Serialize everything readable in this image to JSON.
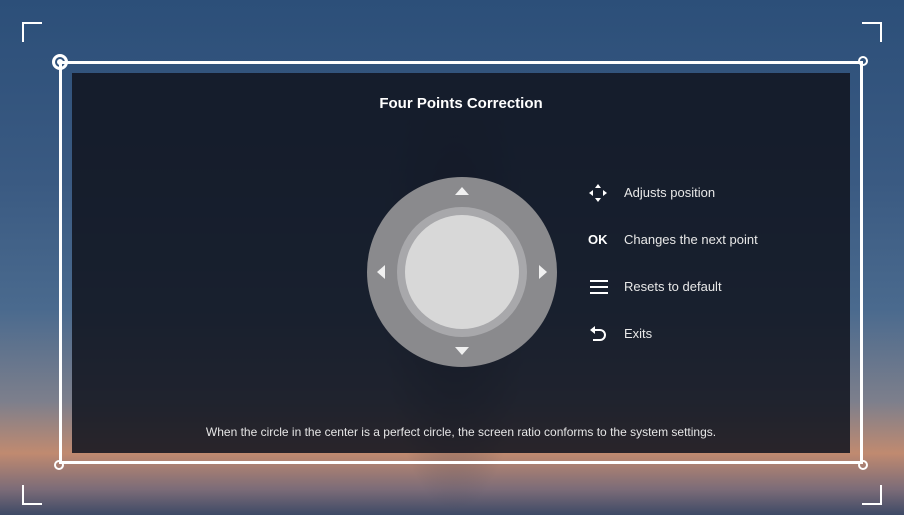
{
  "title": "Four Points Correction",
  "legend": [
    {
      "icon": "directional-arrows-icon",
      "label": "Adjusts position"
    },
    {
      "icon": "ok-icon",
      "icon_text": "OK",
      "label": "Changes the next point"
    },
    {
      "icon": "menu-icon",
      "label": "Resets to default"
    },
    {
      "icon": "back-icon",
      "label": "Exits"
    }
  ],
  "footer_note": "When the circle in the center is a perfect circle, the screen ratio conforms to the system settings.",
  "colors": {
    "panel_bg": "#10141e",
    "frame": "#ffffff",
    "dpad_outer": "#8a8a8d",
    "dpad_ring": "#a8a8ab",
    "dpad_center": "#d8d8d8"
  },
  "selected_corner": "top-left"
}
